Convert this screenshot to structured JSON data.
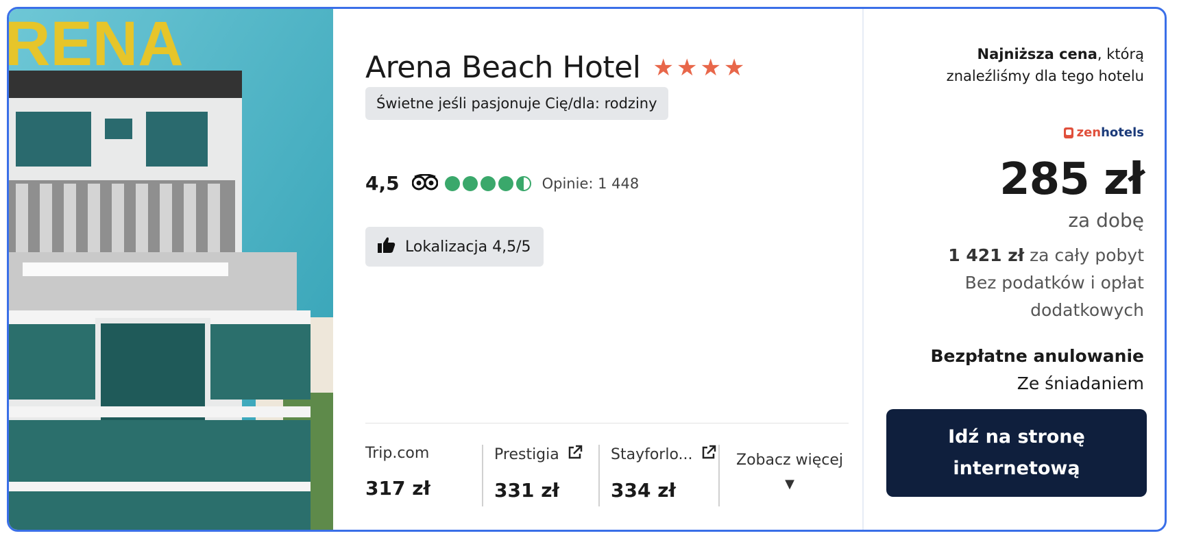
{
  "photo": {
    "sign_text": "RENA",
    "alt": "Arena Beach Hotel"
  },
  "hotel": {
    "name": "Arena Beach Hotel",
    "stars": 4,
    "tag": "Świetne jeśli pasjonuje Cię/dla: rodziny",
    "rating": "4,5",
    "rating_bubbles": 4.5,
    "reviews": "Opinie: 1 448",
    "location_label": "Lokalizacja 4,5/5"
  },
  "other_prices": [
    {
      "name": "Trip.com",
      "price": "317 zł",
      "external": false
    },
    {
      "name": "Prestigia",
      "price": "331 zł",
      "external": true
    },
    {
      "name": "Stayforlo...",
      "price": "334 zł",
      "external": true
    }
  ],
  "see_more": "Zobacz więcej",
  "offer": {
    "lowest_bold": "Najniższa cena",
    "lowest_rest": ", którą",
    "lowest_line2": "znaleźliśmy dla tego hotelu",
    "provider_a": "zen",
    "provider_b": "hotels",
    "price": "285 zł",
    "per_night": "za dobę",
    "total_bold": "1 421 zł",
    "total_rest": "za cały pobyt",
    "taxes_line1": "Bez podatków i opłat",
    "taxes_line2": "dodatkowych",
    "cancellation": "Bezpłatne anulowanie",
    "breakfast": "Ze śniadaniem",
    "cta_line1": "Idź na stronę",
    "cta_line2": "internetową"
  },
  "colors": {
    "border": "#3a6fe8",
    "stars": "#e8674a",
    "bubbles": "#3aa86b",
    "cta_bg": "#0f1f3d"
  }
}
